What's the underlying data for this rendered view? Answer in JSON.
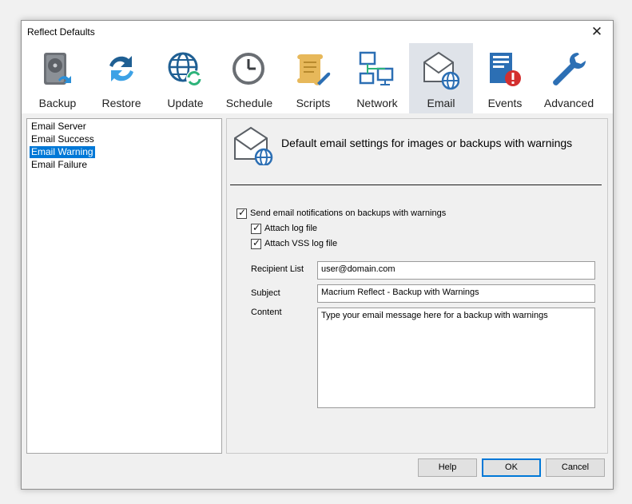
{
  "window": {
    "title": "Reflect Defaults"
  },
  "icons": {
    "close": "close-icon"
  },
  "toolbar": {
    "items": [
      {
        "label": "Backup"
      },
      {
        "label": "Restore"
      },
      {
        "label": "Update"
      },
      {
        "label": "Schedule"
      },
      {
        "label": "Scripts"
      },
      {
        "label": "Network"
      },
      {
        "label": "Email"
      },
      {
        "label": "Events"
      },
      {
        "label": "Advanced"
      }
    ],
    "selected": "Email"
  },
  "sidebar": {
    "items": [
      {
        "label": "Email Server"
      },
      {
        "label": "Email Success"
      },
      {
        "label": "Email Warning"
      },
      {
        "label": "Email Failure"
      }
    ],
    "selected": "Email Warning"
  },
  "panel": {
    "heading": "Default email settings for images or backups with warnings",
    "send_notifications": {
      "label": "Send email notifications on backups with warnings",
      "checked": true
    },
    "attach_log": {
      "label": "Attach log file",
      "checked": true
    },
    "attach_vss_log": {
      "label": "Attach VSS log file",
      "checked": true
    },
    "recipient": {
      "label": "Recipient List",
      "value": "user@domain.com"
    },
    "subject": {
      "label": "Subject",
      "value": "Macrium Reflect - Backup with Warnings"
    },
    "content": {
      "label": "Content",
      "value": "Type your email message here for a backup with warnings"
    }
  },
  "buttons": {
    "help": "Help",
    "ok": "OK",
    "cancel": "Cancel"
  },
  "colors": {
    "selection": "#0078d7",
    "toolbar_selected": "#dfe3e9"
  },
  "checkmark": "✓",
  "close_glyph": "✕"
}
